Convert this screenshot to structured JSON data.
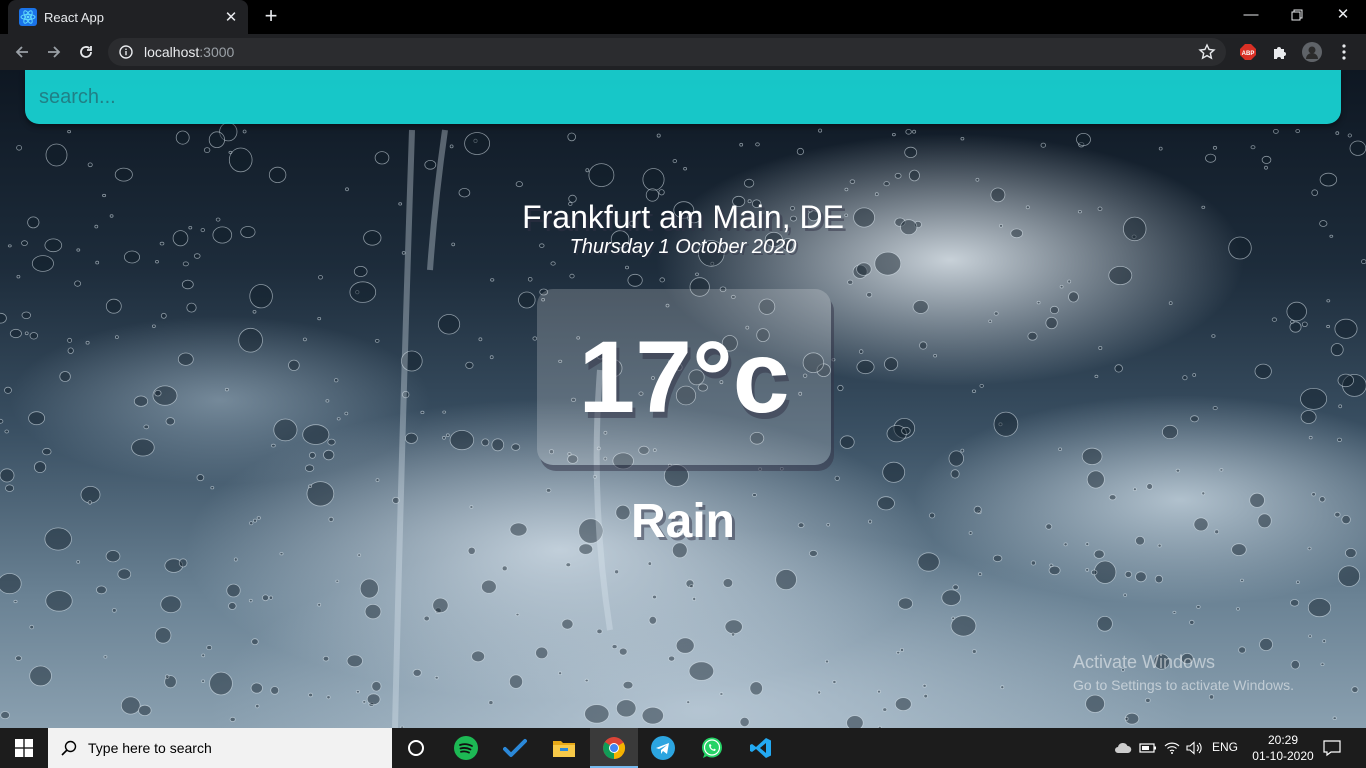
{
  "browser": {
    "tab_title": "React App",
    "url_host": "localhost",
    "url_port": ":3000"
  },
  "extensions": [
    {
      "name": "adblock-icon"
    },
    {
      "name": "extensions-puzzle-icon"
    },
    {
      "name": "profile-avatar"
    }
  ],
  "search": {
    "placeholder": "search...",
    "value": ""
  },
  "weather": {
    "location": "Frankfurt am Main, DE",
    "date": "Thursday 1 October 2020",
    "temperature": "17°c",
    "condition": "Rain"
  },
  "watermark": {
    "title": "Activate Windows",
    "subtitle": "Go to Settings to activate Windows."
  },
  "taskbar": {
    "search_placeholder": "Type here to search",
    "apps": [
      "cortana",
      "spotify",
      "todo",
      "file-explorer",
      "chrome",
      "telegram",
      "whatsapp",
      "vscode"
    ],
    "active_app": "chrome",
    "language": "ENG",
    "time": "20:29",
    "date": "01-10-2020"
  },
  "colors": {
    "search_bar": "#18d6d6",
    "taskbar": "#1c1c1c",
    "chrome_dark": "#202124"
  }
}
